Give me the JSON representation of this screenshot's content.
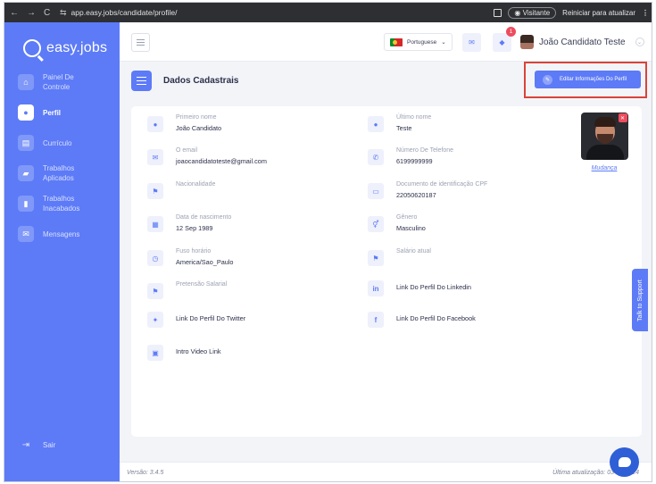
{
  "browser": {
    "url": "app.easy.jobs/candidate/profile/",
    "visitor_label": "Visitante",
    "restart_label": "Reiniciar para atualizar"
  },
  "brand": {
    "name": "easy.jobs"
  },
  "sidebar": {
    "items": [
      {
        "label": "Painel De Controle",
        "icon": "home-icon"
      },
      {
        "label": "Perfil",
        "icon": "person-icon",
        "active": true
      },
      {
        "label": "Currículo",
        "icon": "document-icon"
      },
      {
        "label": "Trabalhos Aplicados",
        "icon": "briefcase-icon"
      },
      {
        "label": "Trabalhos Inacabados",
        "icon": "bookmark-icon"
      },
      {
        "label": "Mensagens",
        "icon": "chat-icon"
      }
    ],
    "logout_label": "Sair"
  },
  "topbar": {
    "language": "Portuguese",
    "notification_count": "1",
    "user_name": "João Candidato Teste"
  },
  "page": {
    "title": "Dados Cadastrais",
    "edit_button": "Editar Informações Do Perfil",
    "photo_change": "Mudança"
  },
  "profile": {
    "first_name_label": "Primeiro nome",
    "first_name": "João Candidato",
    "last_name_label": "Último nome",
    "last_name": "Teste",
    "email_label": "O email",
    "email": "joaocandidatoteste@gmail.com",
    "phone_label": "Número De Telefone",
    "phone": "6199999999",
    "nationality_label": "Nacionalidade",
    "id_label": "Documento de identificação CPF",
    "id_value": "22050620187",
    "birth_label": "Data de nascimento",
    "birth": "12 Sep 1989",
    "gender_label": "Gênero",
    "gender": "Masculino",
    "timezone_label": "Fuso horário",
    "timezone": "America/Sao_Paulo",
    "salary_label": "Salário atual",
    "expected_salary_label": "Pretensão Salarial",
    "linkedin_label": "Link Do Perfil Do Linkedin",
    "twitter_label": "Link Do Perfil Do Twitter",
    "facebook_label": "Link Do Perfil Do Facebook",
    "intro_video_label": "Intro Video Link"
  },
  "support_label": "Talk to Support",
  "footer": {
    "version": "Versão: 3.4.5",
    "updated": "Última atualização: 03-04-2024"
  },
  "colors": {
    "accent": "#5d7bf7",
    "highlight": "#d9443a",
    "danger": "#ee4c5e"
  }
}
